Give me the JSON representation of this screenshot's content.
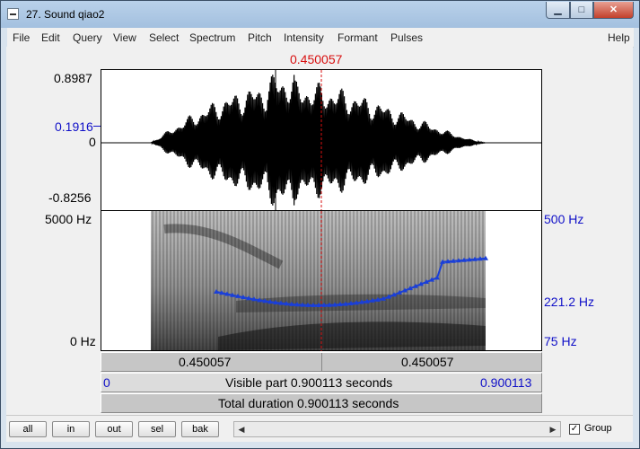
{
  "window": {
    "title": "27. Sound qiao2"
  },
  "menu": [
    "File",
    "Edit",
    "Query",
    "View",
    "Select",
    "Spectrum",
    "Pitch",
    "Intensity",
    "Formant",
    "Pulses",
    "Help"
  ],
  "cursor_time": "0.450057",
  "waveform": {
    "max_label": "0.8987",
    "cursor_value_label": "0.1916",
    "zero_label": "0",
    "min_label": "-0.8256"
  },
  "spectrogram": {
    "top_label": "5000 Hz",
    "bottom_label": "0 Hz"
  },
  "pitch_axis": {
    "top_label": "500 Hz",
    "cursor_label": "221.2 Hz",
    "bottom_label": "75 Hz"
  },
  "time_bar": {
    "left_value": "0.450057",
    "right_value": "0.450057"
  },
  "visible_bar": {
    "start": "0",
    "label": "Visible part 0.900113 seconds",
    "end": "0.900113"
  },
  "total_bar": {
    "label": "Total duration 0.900113 seconds"
  },
  "buttons": {
    "all": "all",
    "in": "in",
    "out": "out",
    "sel": "sel",
    "bak": "bak"
  },
  "group": {
    "label": "Group",
    "checked": true
  },
  "colors": {
    "pitch_curve": "#1a3fd8",
    "cursor": "#d81010",
    "axis_blue": "#1010c8"
  }
}
